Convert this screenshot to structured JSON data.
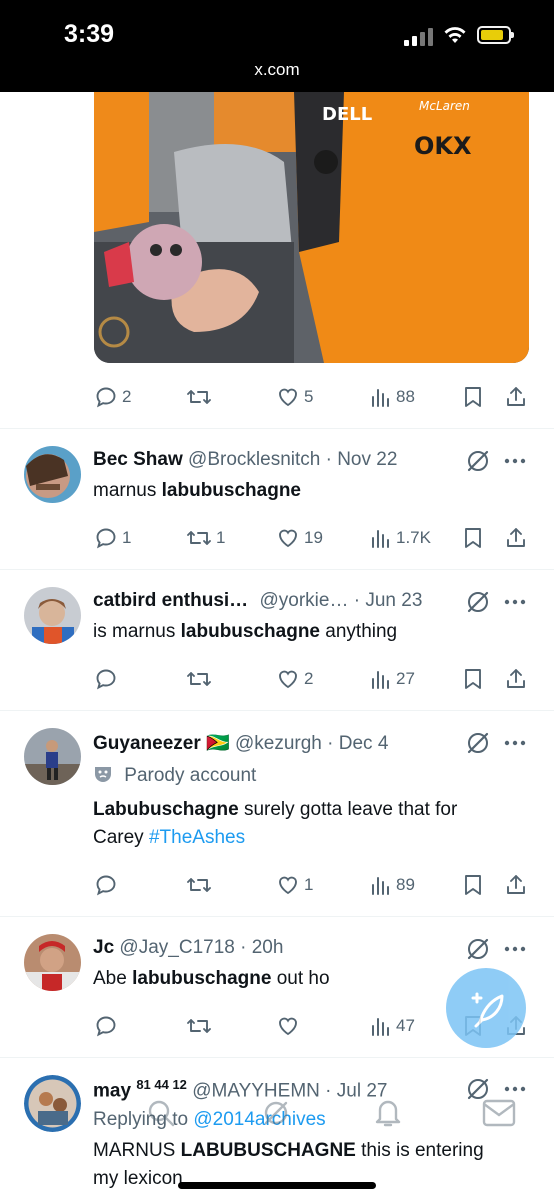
{
  "status": {
    "time": "3:39",
    "url": "x.com"
  },
  "top_post": {
    "replies": "2",
    "reposts": "",
    "likes": "5",
    "views": "88"
  },
  "tweets": [
    {
      "name": "Bec Shaw",
      "handle": "@Brocklesnitch",
      "date": "· Nov 22",
      "text": [
        {
          "t": "marnus "
        },
        {
          "t": "labubuschagne",
          "b": true
        }
      ],
      "replies": "1",
      "reposts": "1",
      "likes": "19",
      "views": "1.7K"
    },
    {
      "name": "catbird enthusi…",
      "handle": "@yorkie…",
      "date": "· Jun 23",
      "text": [
        {
          "t": "is marnus "
        },
        {
          "t": "labubuschagne",
          "b": true
        },
        {
          "t": " anything"
        }
      ],
      "replies": "",
      "reposts": "",
      "likes": "2",
      "views": "27"
    },
    {
      "name": "Guyaneezer",
      "flag": "🇬🇾",
      "handle": "@kezurgh",
      "date": "· Dec 4",
      "parody": "Parody account",
      "text_line1": "surely gotta leave that for",
      "text_bold": "Labubuschagne",
      "text_line2": "Carey",
      "hashtag": "#TheAshes",
      "replies": "",
      "reposts": "",
      "likes": "1",
      "views": "89"
    },
    {
      "name": "Jc",
      "handle": "@Jay_C1718",
      "date": "· 20h",
      "text": [
        {
          "t": "Abe "
        },
        {
          "t": "labubuschagne",
          "b": true
        },
        {
          "t": " out ho"
        }
      ],
      "replies": "",
      "reposts": "",
      "likes": "",
      "views": "47"
    },
    {
      "name": "may",
      "superscript": "81 44 12",
      "handle": "@MAYYHEMN",
      "date": "· Jul 27",
      "replying_prefix": "Replying to",
      "replying_to": "@2014archives",
      "text_bold": "LABUBUSCHAGNE",
      "text_pre": "MARNUS ",
      "text_rest": " this is entering",
      "text_line2": "my lexicon"
    }
  ],
  "icons": {
    "reply": "reply-icon",
    "repost": "repost-icon",
    "like": "heart-icon",
    "views": "views-icon",
    "bookmark": "bookmark-icon",
    "share": "share-icon",
    "grok": "grok-icon",
    "more": "more-icon",
    "compose": "compose-icon"
  },
  "colors": {
    "accent": "#1d9bf0",
    "secondary_text": "#536471",
    "fab": "#7cc4f5",
    "battery": "#f5d90a"
  }
}
